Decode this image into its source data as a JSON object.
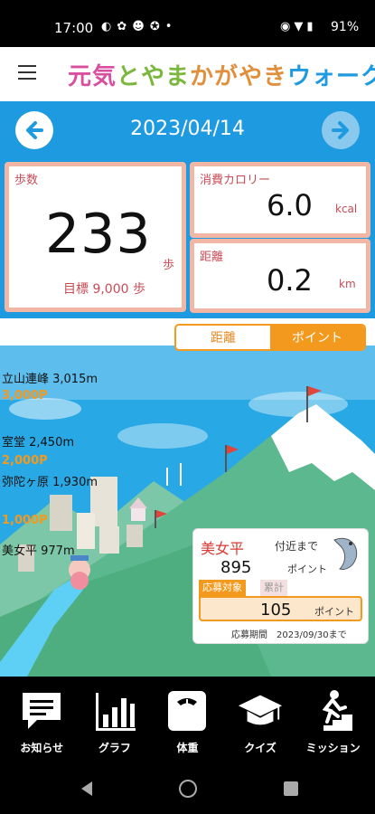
{
  "status_bar": {
    "time": "17:00",
    "left_icons": [
      "notification-icon",
      "paw-icon",
      "cat-icon",
      "toy-icon",
      "dot-icon"
    ],
    "right_icons": [
      "data-saver-icon",
      "wifi-icon",
      "battery-icon"
    ],
    "battery": "91%"
  },
  "header": {
    "title_parts": [
      {
        "text": "元気",
        "color": "#d94fa0"
      },
      {
        "text": "とやま",
        "color": "#7ab73c"
      },
      {
        "text": "かがやき",
        "color": "#e08f3d"
      },
      {
        "text": "ウォーク",
        "color": "#1e9ae0"
      }
    ]
  },
  "date": "2023/04/14",
  "stats": {
    "steps_label": "歩数",
    "steps_value": "233",
    "steps_unit": "歩",
    "goal_text": "目標 9,000 歩",
    "kcal_label": "消費カロリー",
    "kcal_value": "6.0",
    "kcal_unit": "kcal",
    "dist_label": "距離",
    "dist_value": "0.2",
    "dist_unit": "km"
  },
  "toggle": {
    "distance": "距離",
    "points": "ポイント",
    "selected": "points"
  },
  "mountain_labels": [
    {
      "name": "立山連峰 3,015m",
      "points": "3,000P"
    },
    {
      "name": "室堂 2,450m",
      "points": "2,000P"
    },
    {
      "name": "弥陀ヶ原 1,930m",
      "points": "1,000P"
    },
    {
      "name": "美女平 977m",
      "points": ""
    }
  ],
  "info_card": {
    "name": "美女平",
    "near_text": "付近まで",
    "remaining": "895",
    "remaining_unit": "ポイント",
    "tab_apply": "応募対象",
    "tab_total": "累計",
    "apply_points": "105",
    "apply_unit": "ポイント",
    "period": "応募期間　2023/09/30まで"
  },
  "tabs": [
    {
      "label": "お知らせ",
      "icon": "notice-icon"
    },
    {
      "label": "グラフ",
      "icon": "graph-icon"
    },
    {
      "label": "体重",
      "icon": "scale-icon"
    },
    {
      "label": "クイズ",
      "icon": "graduation-cap-icon"
    },
    {
      "label": "ミッション",
      "icon": "stairs-runner-icon"
    }
  ],
  "colors": {
    "accent_blue": "#1e9ae0",
    "card_border": "#f2b6a5",
    "label_red": "#c94a55",
    "orange": "#f39a1e"
  }
}
